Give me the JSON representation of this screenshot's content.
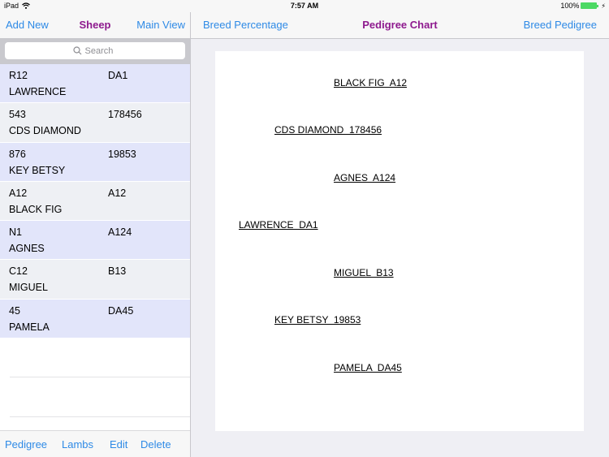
{
  "status_bar": {
    "device": "iPad",
    "wifi_icon": "wifi-icon",
    "time": "7:57 AM",
    "battery_percent": "100%",
    "battery_level": 1.0,
    "charging_icon": "bolt-icon"
  },
  "left_nav": {
    "add_new_label": "Add New",
    "title": "Sheep",
    "main_view_label": "Main View"
  },
  "search": {
    "placeholder": "Search",
    "value": ""
  },
  "sheep_list": [
    {
      "tag": "R12",
      "registration": "DA1",
      "name": "LAWRENCE"
    },
    {
      "tag": "543",
      "registration": "178456",
      "name": "CDS DIAMOND"
    },
    {
      "tag": "876",
      "registration": "19853",
      "name": "KEY BETSY"
    },
    {
      "tag": "A12",
      "registration": "A12",
      "name": "BLACK FIG"
    },
    {
      "tag": "N1",
      "registration": "A124",
      "name": "AGNES"
    },
    {
      "tag": "C12",
      "registration": "B13",
      "name": "MIGUEL"
    },
    {
      "tag": "45",
      "registration": "DA45",
      "name": "PAMELA"
    }
  ],
  "left_toolbar": {
    "pedigree_label": "Pedigree",
    "lambs_label": "Lambs",
    "edit_label": "Edit",
    "delete_label": "Delete"
  },
  "right_nav": {
    "breed_percentage_label": "Breed Percentage",
    "title": "Pedigree Chart",
    "breed_pedigree_label": "Breed Pedigree"
  },
  "pedigree": {
    "subject": "LAWRENCE  DA1",
    "sire": "CDS DIAMOND  178456",
    "sire_sire": "BLACK FIG  A12",
    "sire_dam": "AGNES  A124",
    "dam": "KEY BETSY  19853",
    "dam_sire": "MIGUEL  B13",
    "dam_dam": "PAMELA  DA45"
  },
  "colors": {
    "accent": "#2e8ae6",
    "title": "#8e1a8e",
    "row_odd": "#e2e5fa",
    "row_even": "#eef0f4",
    "battery": "#4cd964"
  }
}
